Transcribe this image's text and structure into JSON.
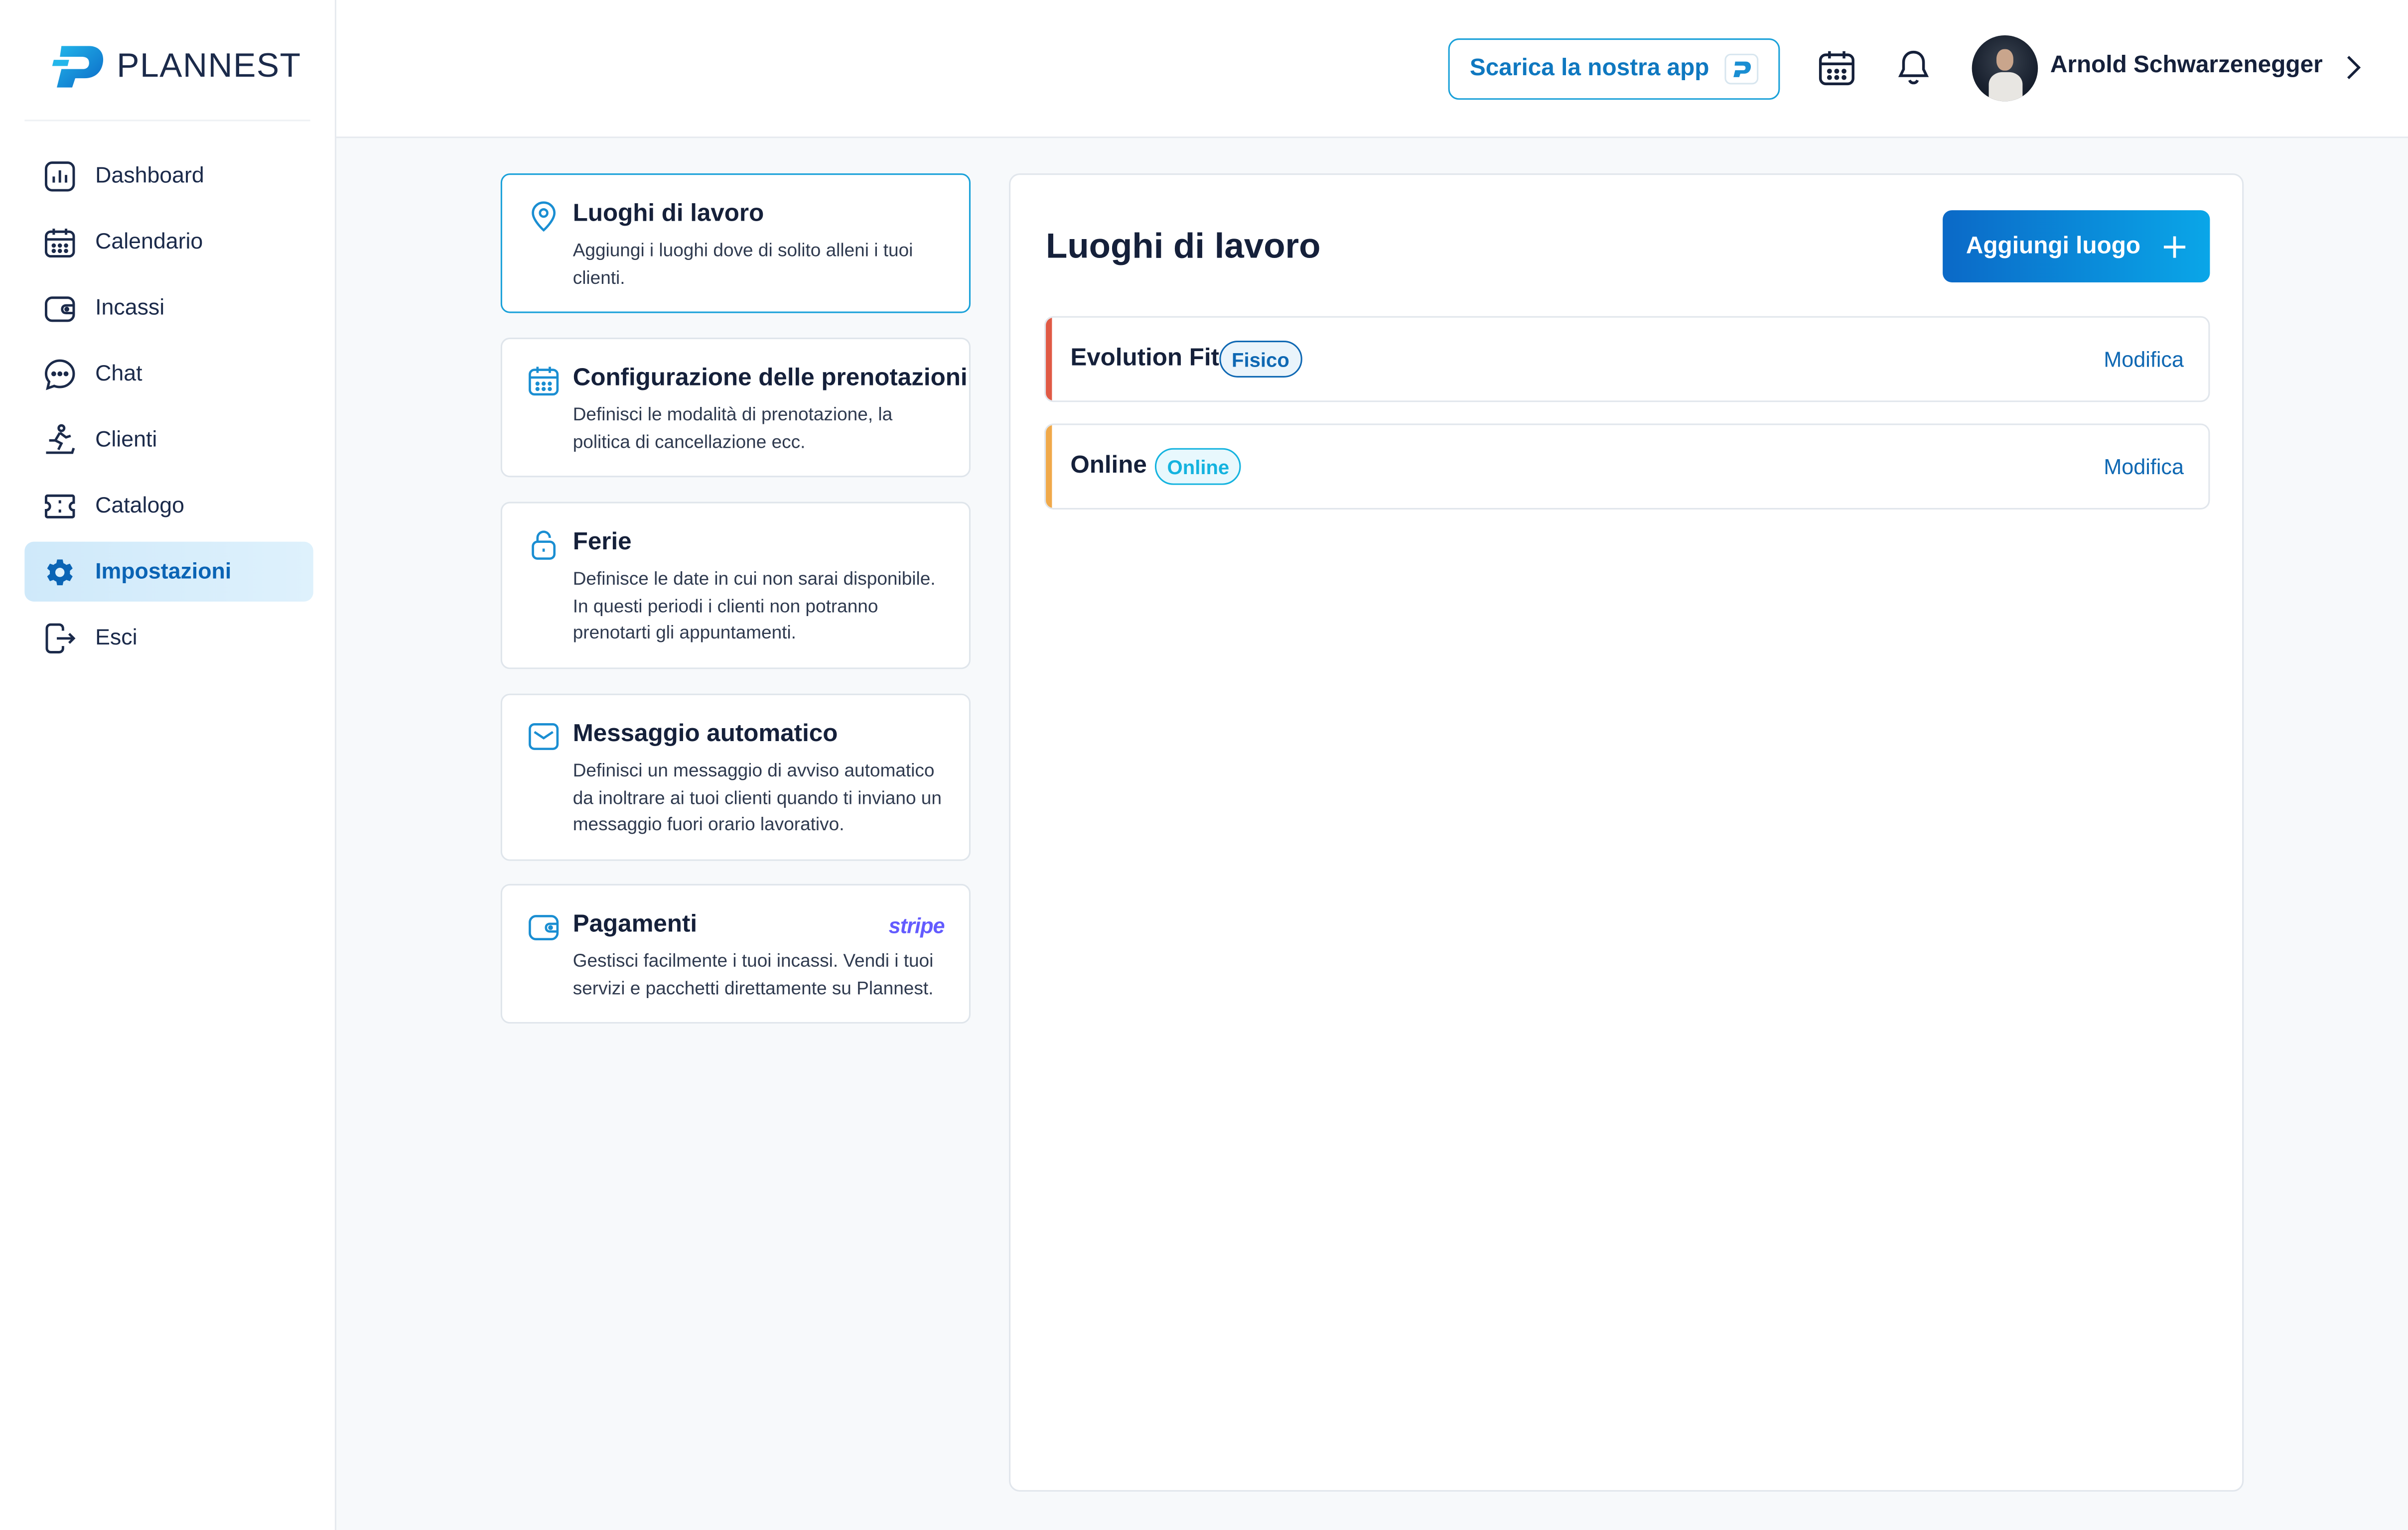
{
  "app": {
    "logo_text": "PLANNEST"
  },
  "sidebar": {
    "items": [
      {
        "label": "Dashboard",
        "icon": "chart-bars-icon",
        "active": false
      },
      {
        "label": "Calendario",
        "icon": "calendar-icon",
        "active": false
      },
      {
        "label": "Incassi",
        "icon": "wallet-icon",
        "active": false
      },
      {
        "label": "Chat",
        "icon": "chat-bubble-icon",
        "active": false
      },
      {
        "label": "Clienti",
        "icon": "treadmill-runner-icon",
        "active": false
      },
      {
        "label": "Catalogo",
        "icon": "ticket-icon",
        "active": false
      },
      {
        "label": "Impostazioni",
        "icon": "gear-icon",
        "active": true
      },
      {
        "label": "Esci",
        "icon": "logout-icon",
        "active": false
      }
    ]
  },
  "header": {
    "download_label": "Scarica la nostra app",
    "user_name": "Arnold Schwarzenegger"
  },
  "settings_menu": [
    {
      "title": "Luoghi di lavoro",
      "desc": "Aggiungi i luoghi dove di solito alleni i tuoi clienti.",
      "icon": "location-pin-icon",
      "active": true
    },
    {
      "title": "Configurazione delle prenotazioni",
      "desc": "Definisci le modalità di prenotazione, la politica di cancellazione ecc.",
      "icon": "calendar-icon",
      "active": false
    },
    {
      "title": "Ferie",
      "desc": "Definisce le date in cui non sarai disponibile. In questi periodi i clienti non potranno prenotarti gli appuntamenti.",
      "icon": "lock-icon",
      "active": false
    },
    {
      "title": "Messaggio automatico",
      "desc": "Definisci un messaggio di avviso automatico da inoltrare ai tuoi clienti quando ti inviano un messaggio fuori orario lavorativo.",
      "icon": "envelope-icon",
      "active": false
    },
    {
      "title": "Pagamenti",
      "desc": "Gestisci facilmente i tuoi incassi. Vendi i tuoi servizi e pacchetti direttamente su Plannest.",
      "icon": "wallet-icon",
      "active": false,
      "brand": "stripe"
    }
  ],
  "panel": {
    "title": "Luoghi di lavoro",
    "add_label": "Aggiungi luogo",
    "locations": [
      {
        "name": "Evolution Fit",
        "badge": "Fisico",
        "edit_label": "Modifica",
        "accent": "#e05a45",
        "badge_color": "#0f68b3"
      },
      {
        "name": "Online",
        "badge": "Online",
        "edit_label": "Modifica",
        "accent": "#f0a94a",
        "badge_color": "#14b3df"
      }
    ]
  },
  "colors": {
    "primary": "#0f78c0",
    "accent_cyan": "#1aa1d9",
    "stripe": "#635bff"
  }
}
